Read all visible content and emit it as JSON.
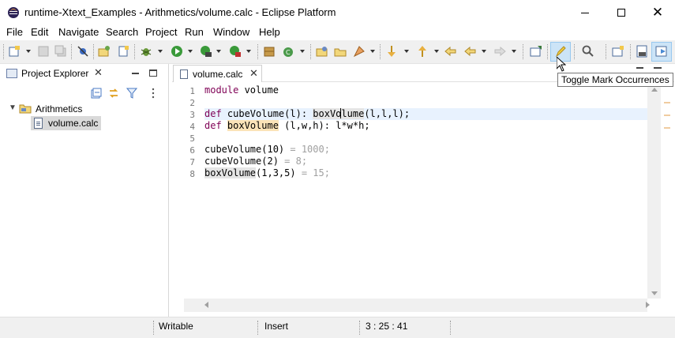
{
  "window": {
    "title": "runtime-Xtext_Examples - Arithmetics/volume.calc - Eclipse Platform",
    "minimize_glyph": "",
    "close_glyph": "✕"
  },
  "menu": [
    "File",
    "Edit",
    "Navigate",
    "Search",
    "Project",
    "Run",
    "Window",
    "Help"
  ],
  "tooltip": "Toggle Mark Occurrences",
  "project_explorer": {
    "tab_label": "Project Explorer",
    "close_glyph": "✕",
    "project": "Arithmetics",
    "file": "volume.calc"
  },
  "editor": {
    "tab_label": "volume.calc",
    "close_glyph": "✕",
    "line_numbers": [
      "1",
      "2",
      "3",
      "4",
      "5",
      "6",
      "7",
      "8"
    ],
    "tokens": {
      "l1_kw": "module",
      "l1_rest": " volume",
      "l3_kw": "def",
      "l3_a": " cubeVolume(l): ",
      "l3_occ_before_caret": "boxVo",
      "l3_occ_after_caret": "lume",
      "l3_rest": "(l,l,l);",
      "l4_kw": "def",
      "l4_a": " ",
      "l4_occ": "boxVolume",
      "l4_rest": " (l,w,h): l*w*h;",
      "l6_code": "cubeVolume(10)",
      "l6_val": " = 1000;",
      "l6_semicolon": "",
      "l7_code": "cubeVolume(2)",
      "l7_val": " = 8;",
      "l8_occ": "boxVolume",
      "l8_code": "(1,3,5)",
      "l8_val": " = 15;"
    }
  },
  "status": {
    "writable": "Writable",
    "insert_mode": "Insert",
    "position": "3 : 25 : 41"
  },
  "colors": {
    "keyword": "#7f0055",
    "occurrence_highlight": "#e5e5e5",
    "write_occurrence_highlight": "#fbe3b8",
    "current_line": "#e8f2fe",
    "toolbar_active": "#cce4f7"
  }
}
